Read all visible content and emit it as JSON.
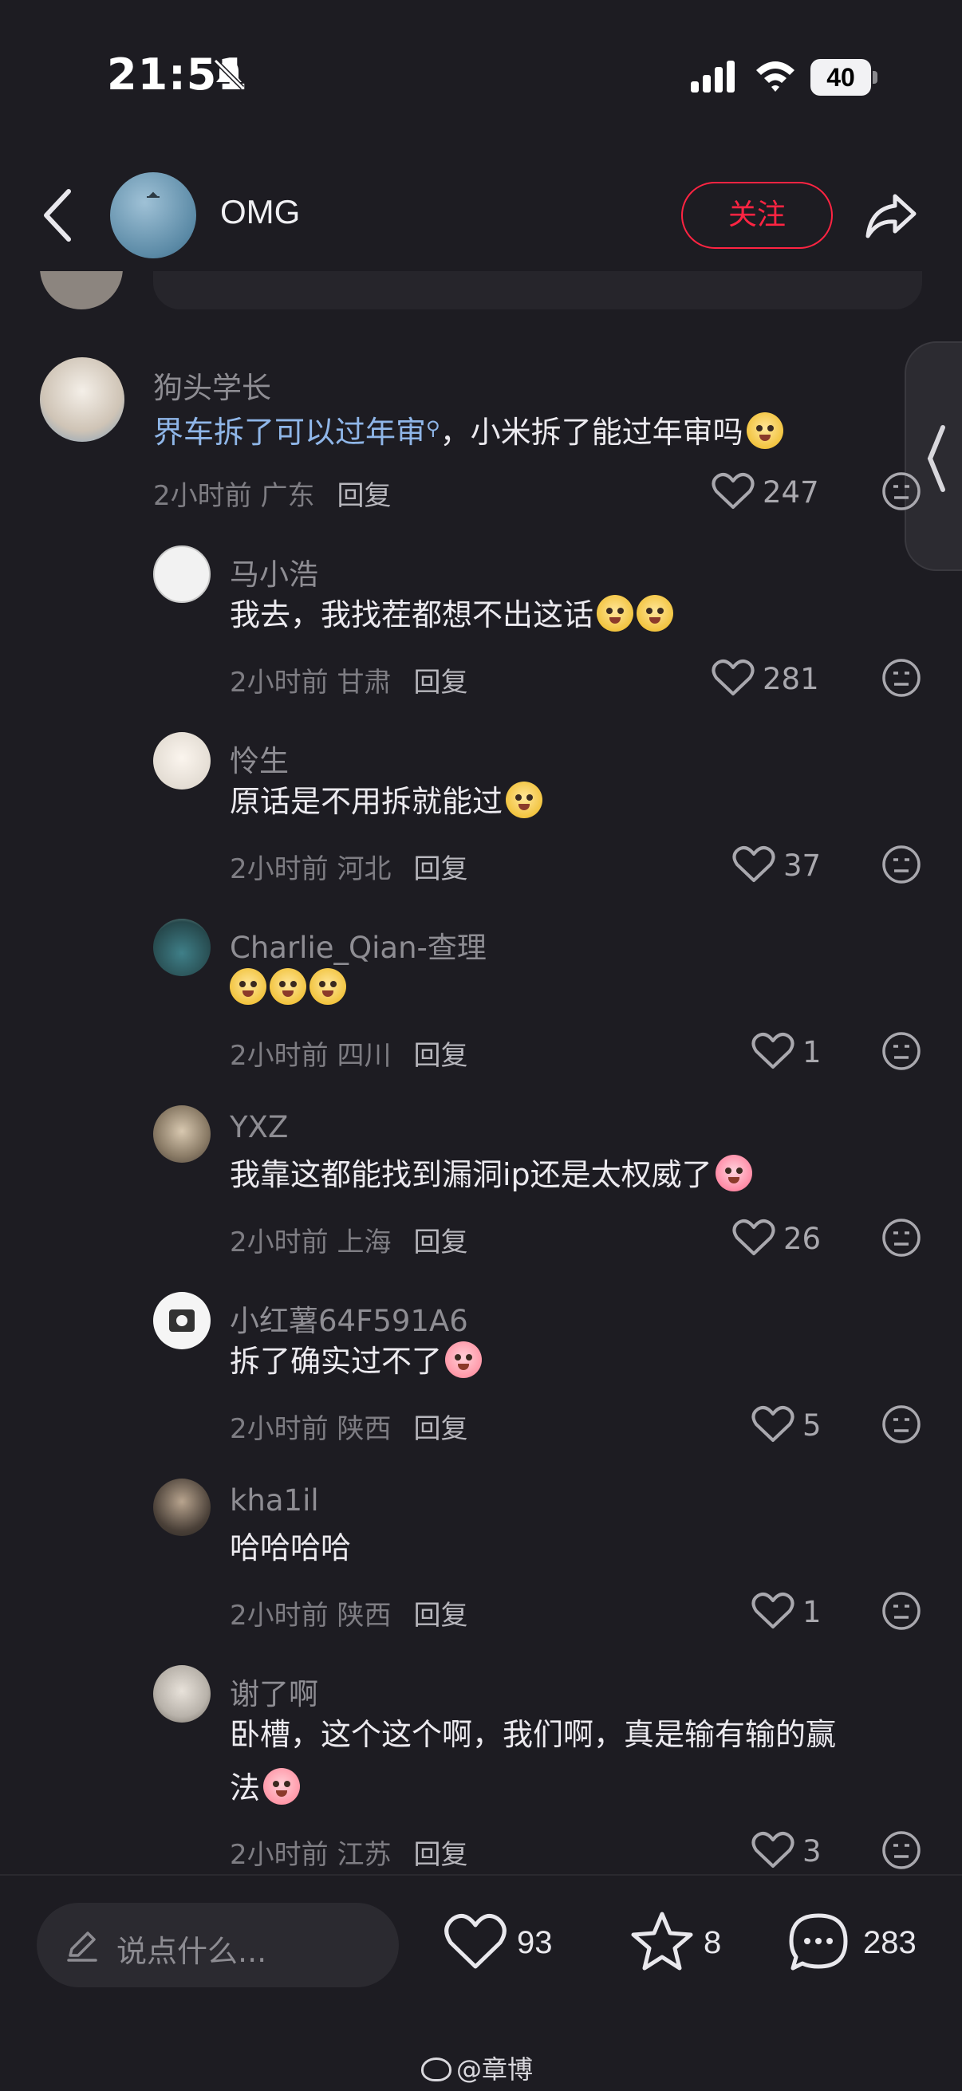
{
  "status_bar": {
    "time": "21:51",
    "battery": "40"
  },
  "header": {
    "author_name": "OMG",
    "follow_label": "关注"
  },
  "comments": [
    {
      "name": "狗头学长",
      "text_link": "界车拆了可以过年审",
      "text_rest": "，小米拆了能过年审吗",
      "time": "2小时前",
      "region": "广东",
      "reply": "回复",
      "likes": "247",
      "avatar_color": "#d9cfc2"
    },
    {
      "name": "马小浩",
      "text": "我去，我找茬都想不出这话",
      "time": "2小时前",
      "region": "甘肃",
      "reply": "回复",
      "likes": "281",
      "avatar_color": "#f2f2f2"
    },
    {
      "name": "怜生",
      "text": "原话是不用拆就能过",
      "time": "2小时前",
      "region": "河北",
      "reply": "回复",
      "likes": "37",
      "avatar_color": "#e9e3da"
    },
    {
      "name": "Charlie_Qian-查理",
      "text": "",
      "time": "2小时前",
      "region": "四川",
      "reply": "回复",
      "likes": "1",
      "avatar_color": "#4f8a86"
    },
    {
      "name": "YXZ",
      "text": "我靠这都能找到漏洞ip还是太权威了",
      "time": "2小时前",
      "region": "上海",
      "reply": "回复",
      "likes": "26",
      "avatar_color": "#8a7b66"
    },
    {
      "name": "小红薯64F591A6",
      "text": "拆了确实过不了",
      "time": "2小时前",
      "region": "陕西",
      "reply": "回复",
      "likes": "5",
      "avatar_color": "#f5f5f5"
    },
    {
      "name": "kha1il",
      "text": "哈哈哈哈",
      "time": "2小时前",
      "region": "陕西",
      "reply": "回复",
      "likes": "1",
      "avatar_color": "#5a5248"
    },
    {
      "name": "谢了啊",
      "text_line1": "卧槽，这个这个啊，我们啊，真是输有输的赢",
      "text_line2": "法",
      "time": "2小时前",
      "region": "江苏",
      "reply": "回复",
      "likes": "3",
      "avatar_color": "#b8b2aa"
    }
  ],
  "bottom_bar": {
    "input_placeholder": "说点什么...",
    "likes": "93",
    "stars": "8",
    "comments": "283"
  },
  "watermark": "@章博",
  "colors": {
    "background": "#1d1c22",
    "accent": "#ff2442",
    "link": "#8fb6e8"
  }
}
